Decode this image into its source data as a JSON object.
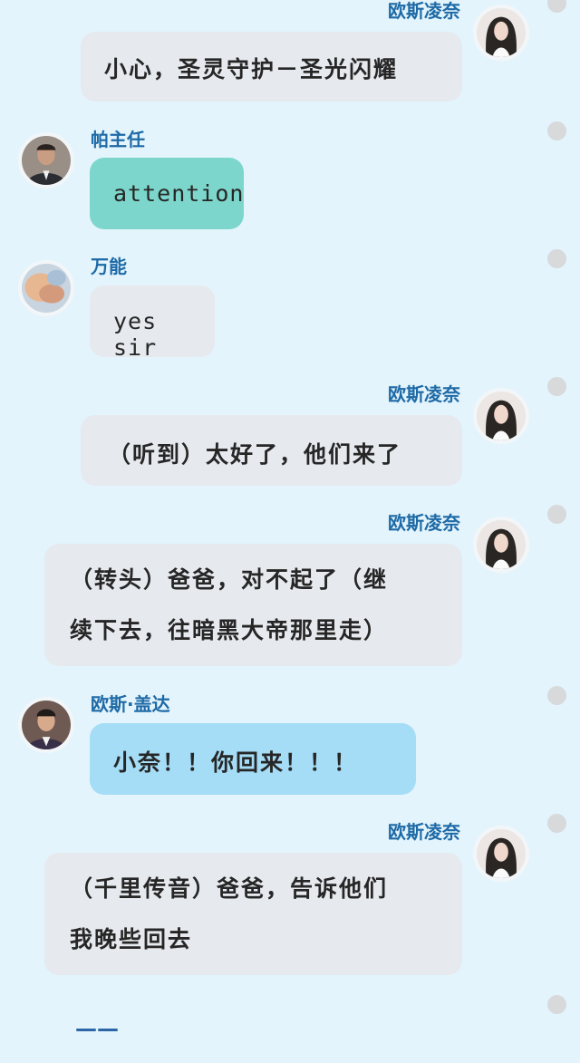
{
  "messages": [
    {
      "sender": "欧斯凌奈",
      "side": "right",
      "avatar": "girl-avatar-icon",
      "text": "小心，圣灵守护－圣光闪耀"
    },
    {
      "sender": "帕主任",
      "side": "left",
      "avatar": "man-suit-avatar-icon",
      "text": "attention"
    },
    {
      "sender": "万能",
      "side": "left",
      "avatar": "abstract-avatar-icon",
      "text": "yes sir"
    },
    {
      "sender": "欧斯凌奈",
      "side": "right",
      "avatar": "girl-avatar-icon",
      "text": "（听到）太好了，他们来了"
    },
    {
      "sender": "欧斯凌奈",
      "side": "right",
      "avatar": "girl-avatar-icon",
      "line1": "（转头）爸爸，对不起了（继",
      "line2": "续下去，往暗黑大帝那里走）"
    },
    {
      "sender": "欧斯·盖达",
      "side": "left",
      "avatar": "man-avatar-icon",
      "text": "小奈！！你回来！！！"
    },
    {
      "sender": "欧斯凌奈",
      "side": "right",
      "avatar": "girl-avatar-icon",
      "line1": "（千里传音）爸爸，告诉他们",
      "line2": "我晚些回去"
    }
  ],
  "ellipsis": "——",
  "colors": {
    "background": "#e3f4fc",
    "name": "#1e6aa6",
    "bubble_gray": "#e6e9ee",
    "bubble_teal": "#7dd6cb",
    "bubble_blue": "#a5dcf6",
    "dot": "#d7d9db"
  }
}
